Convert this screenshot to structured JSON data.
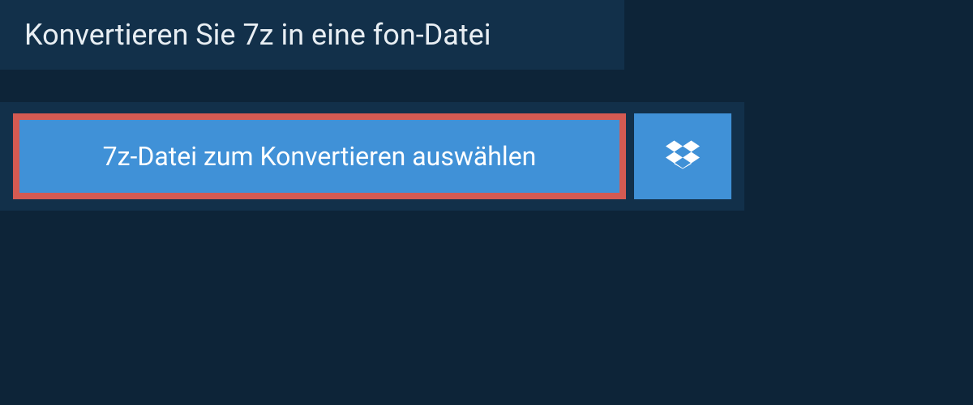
{
  "header": {
    "title": "Konvertieren Sie 7z in eine fon-Datei"
  },
  "actions": {
    "select_file_label": "7z-Datei zum Konvertieren auswählen",
    "dropbox_icon": "dropbox-icon"
  },
  "colors": {
    "background_dark": "#0d2438",
    "panel": "#12304a",
    "button_blue": "#4091d7",
    "highlight_border": "#d45a52",
    "text_light": "#e8eef3",
    "text_white": "#ffffff"
  }
}
